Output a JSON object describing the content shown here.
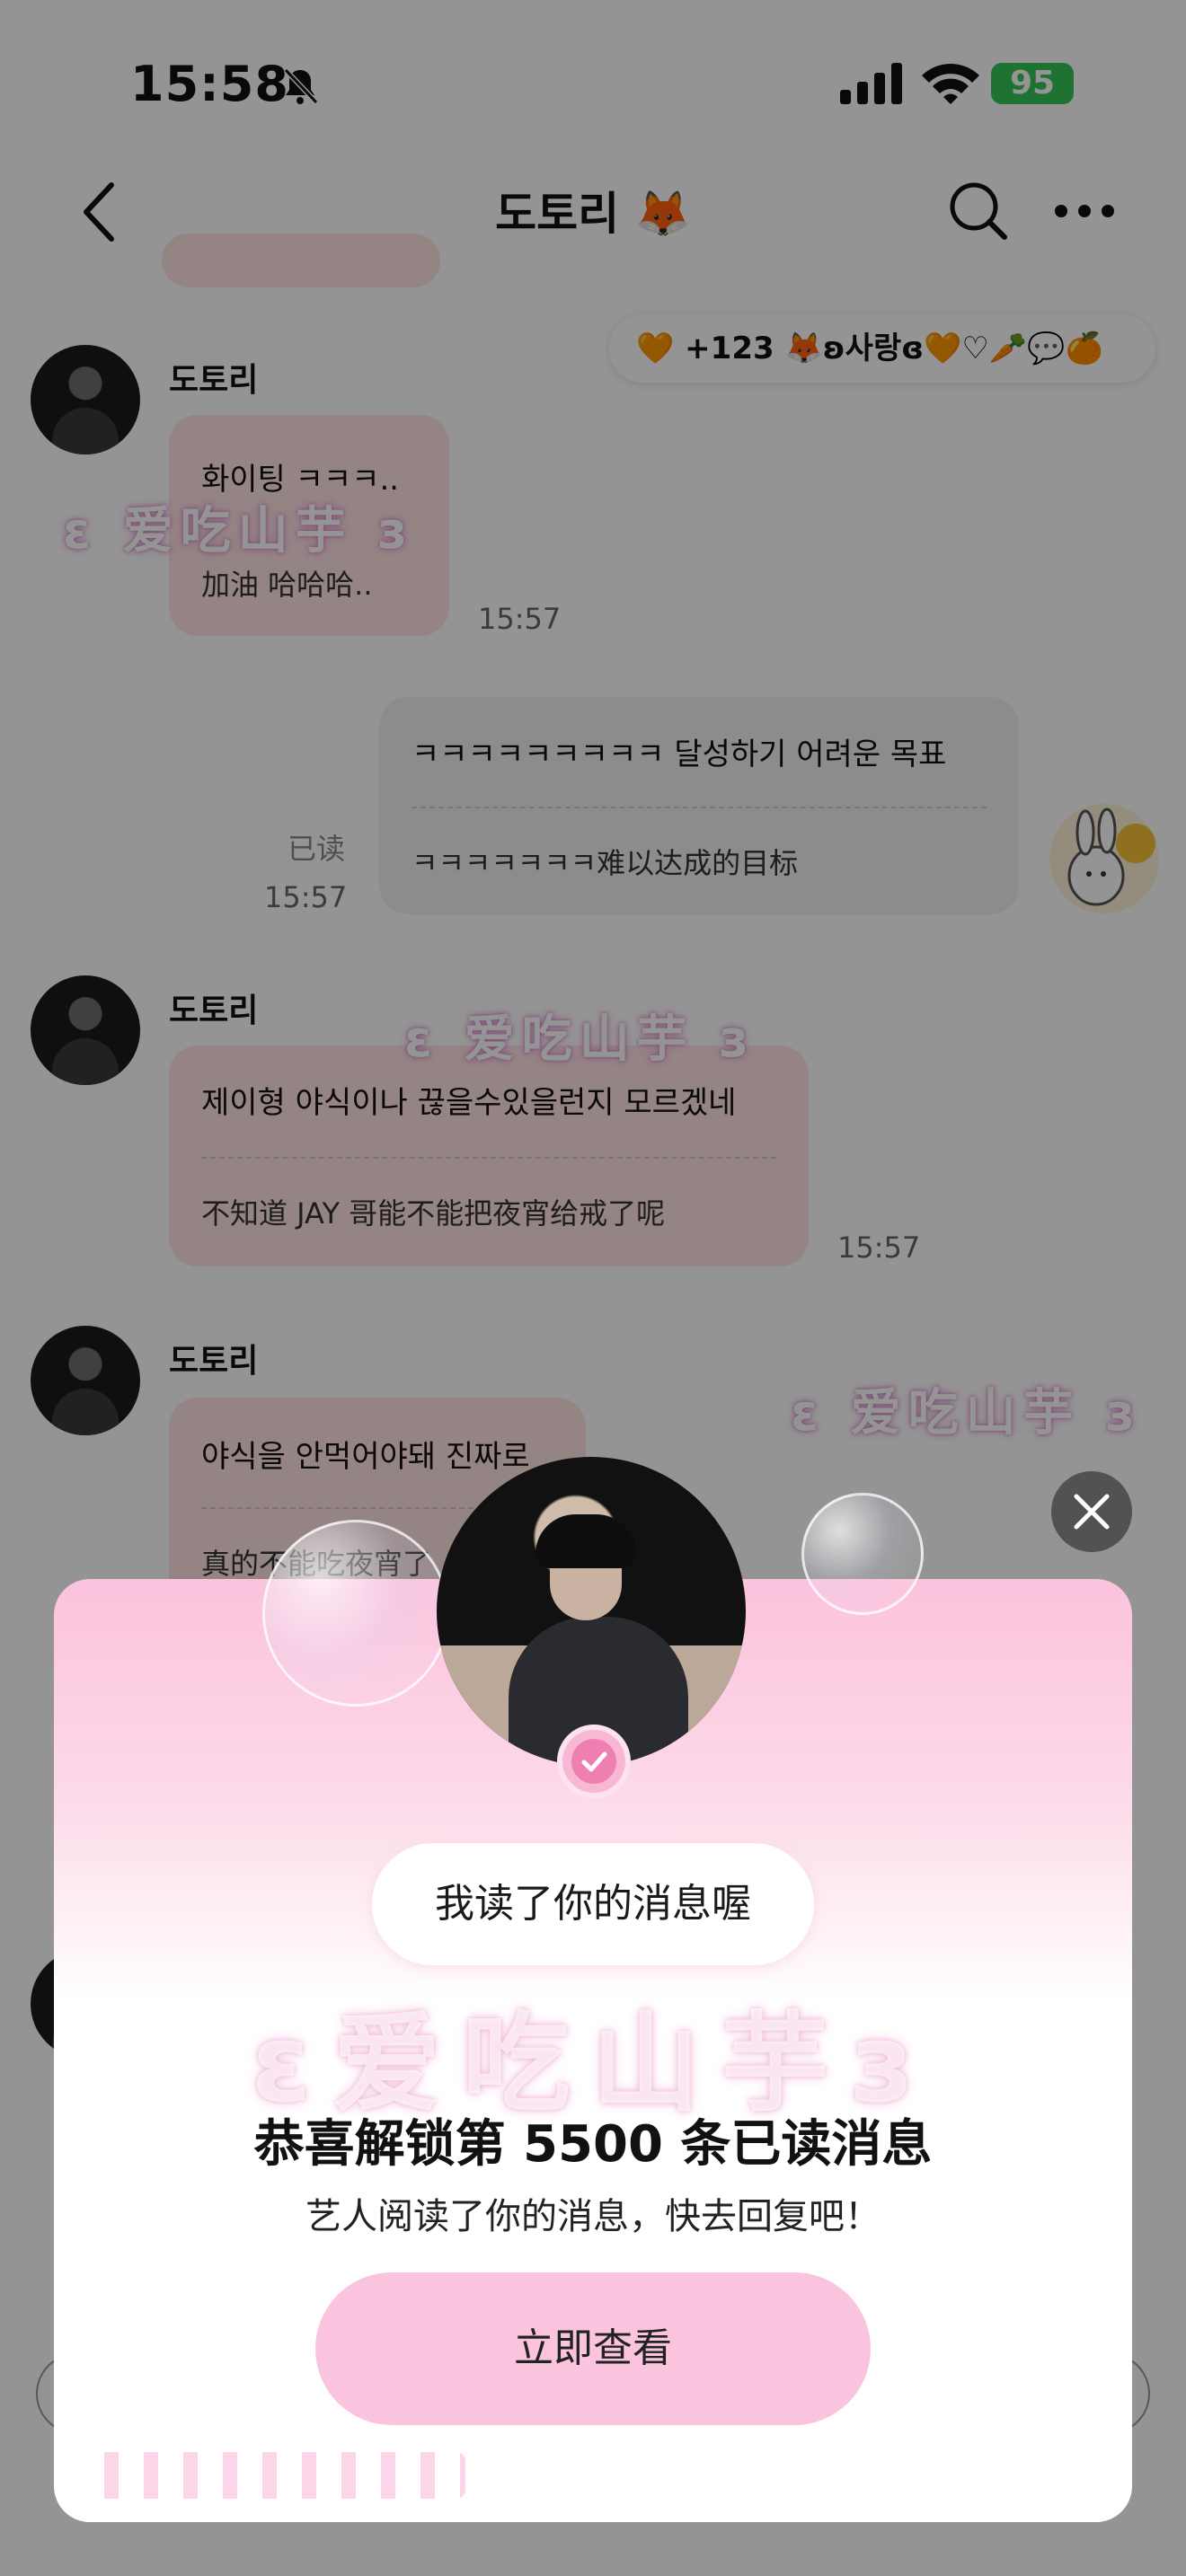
{
  "status_bar": {
    "time": "15:58",
    "battery": "95"
  },
  "header": {
    "title": "도토리 🦊"
  },
  "reaction_pill": {
    "text": "🧡 +123 🦊ʚ사랑ɞ🧡♡🥕💬🍊"
  },
  "messages": [
    {
      "sender": "도토리",
      "ko": "화이팅 ㅋㅋㅋ..",
      "zh": "加油 哈哈哈..",
      "time": "15:57"
    },
    {
      "ko": "ㅋㅋㅋㅋㅋㅋㅋㅋㅋ 달성하기 어려운 목표",
      "zh": "ㅋㅋㅋㅋㅋㅋㅋ难以达成的目标",
      "read": "已读",
      "time": "15:57"
    },
    {
      "sender": "도토리",
      "ko": "제이형 야식이나 끊을수있을런지 모르겠네",
      "zh": "不知道 JAY 哥能不能把夜宵给戒了呢",
      "time": "15:57"
    },
    {
      "sender": "도토리",
      "ko": "야식을 안먹어야돼 진짜로",
      "zh": "真的不能吃夜宵了"
    }
  ],
  "watermark": "爱吃山芋",
  "popup": {
    "pill": "我读了你的消息喔",
    "title": "恭喜解锁第 5500 条已读消息",
    "subtitle": "艺人阅读了你的消息，快去回复吧！",
    "cta": "立即查看"
  },
  "colors": {
    "accent_pink": "#fbc4de",
    "bubble_pink": "#ffe3e3",
    "battery_green": "#34c759"
  }
}
